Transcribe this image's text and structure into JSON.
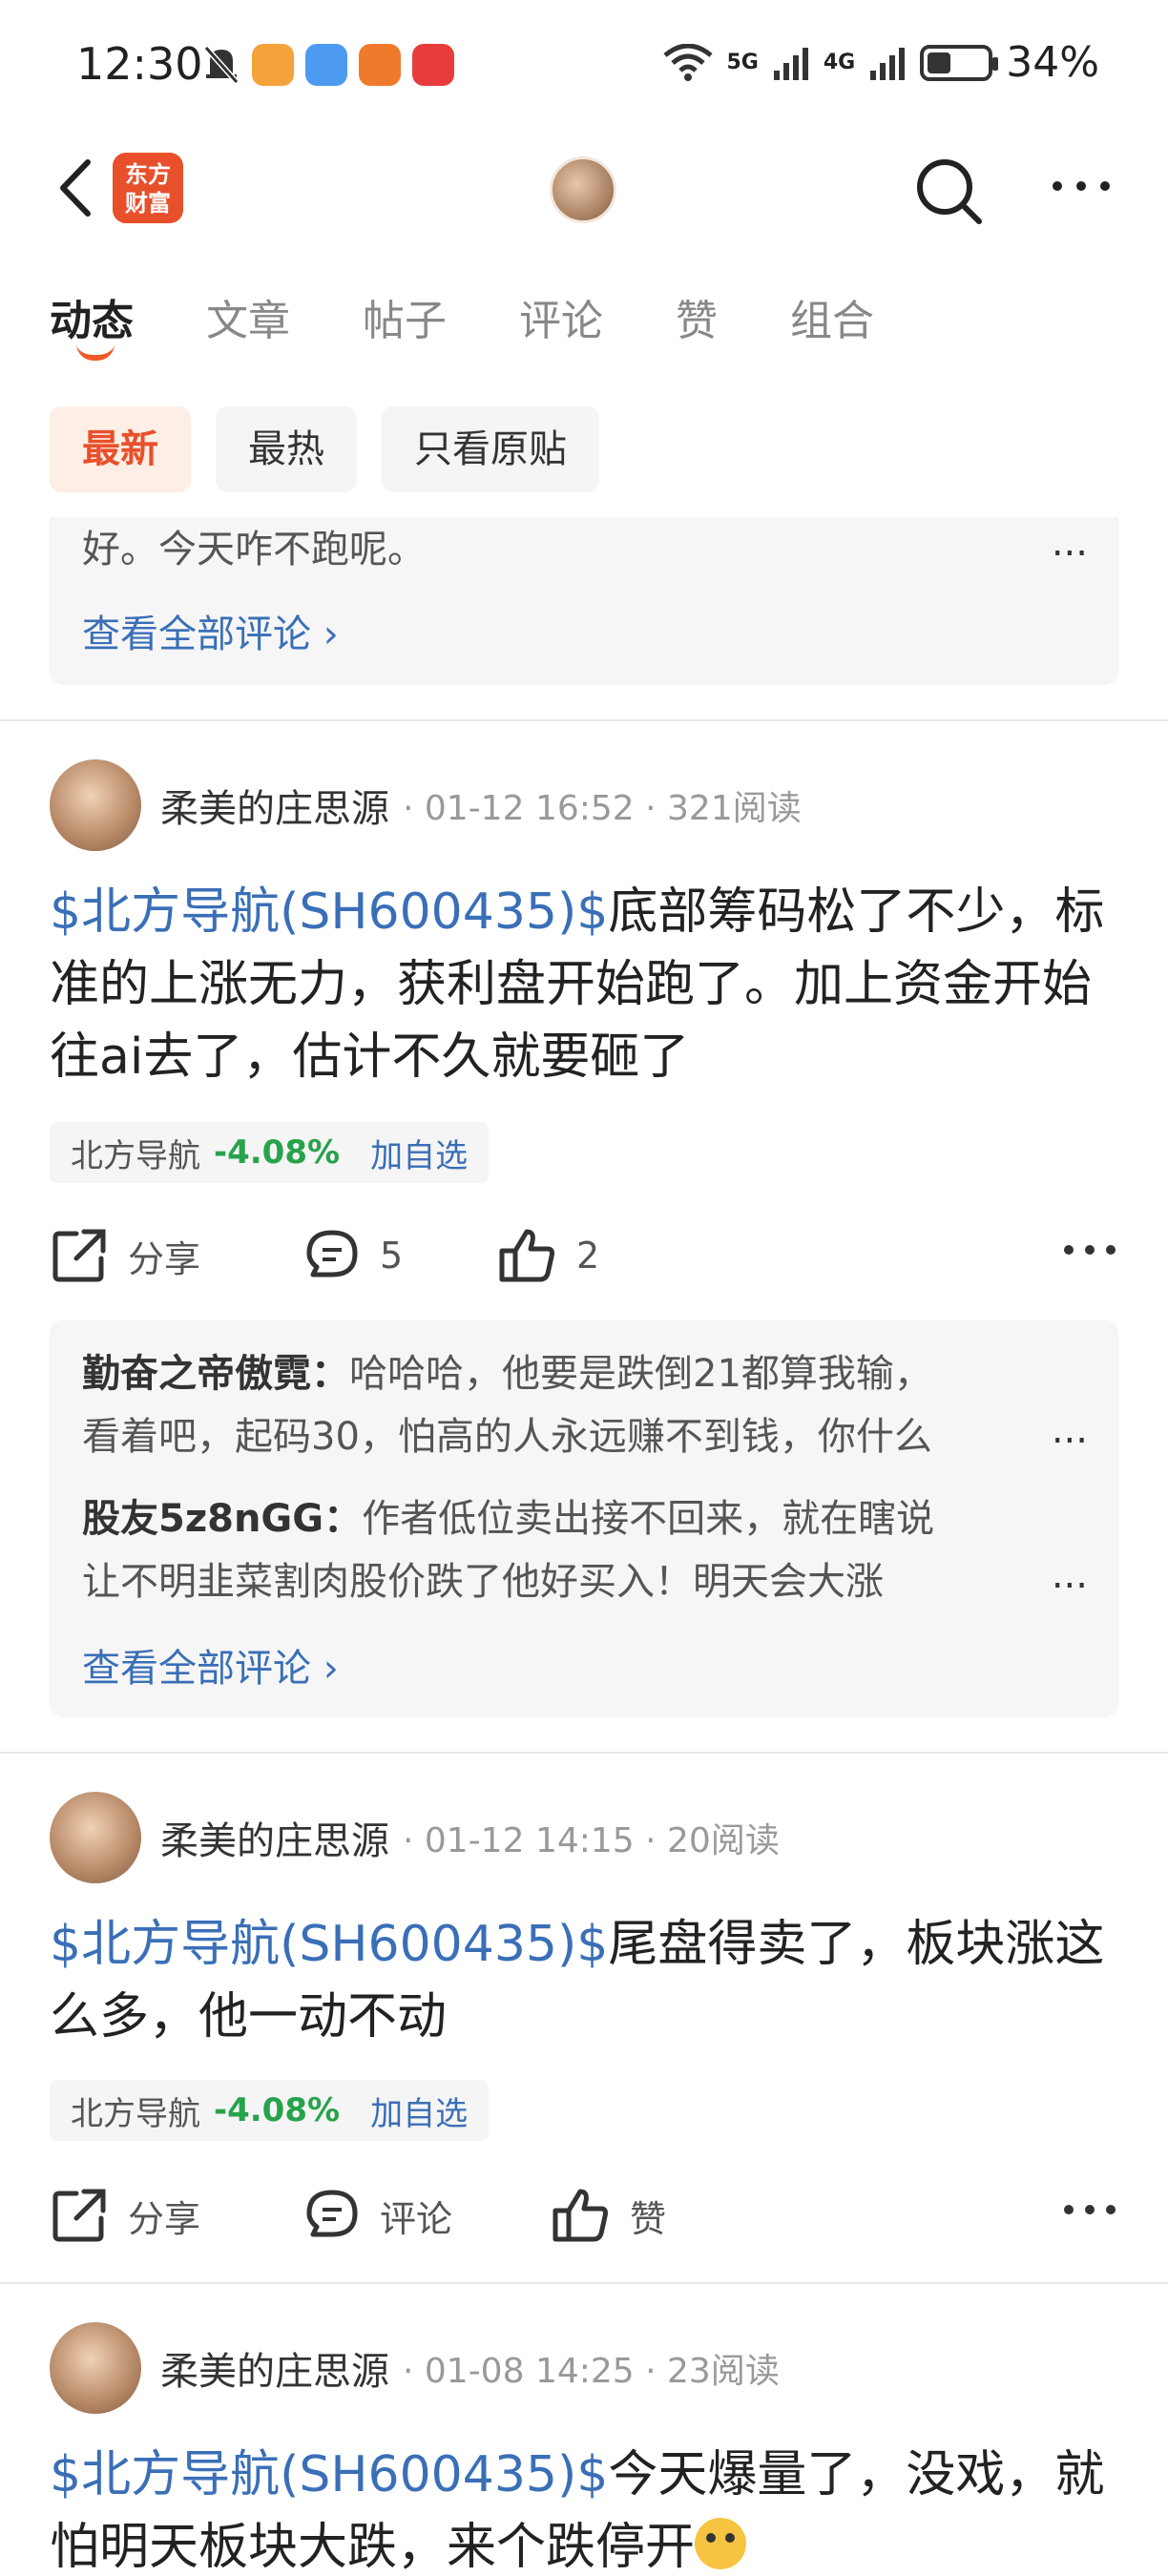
{
  "status_bar": {
    "time": "12:30",
    "net1": "5G",
    "net2": "4G",
    "battery": "34%"
  },
  "nav": {
    "logo_text": "东方\n财富"
  },
  "tabs": [
    {
      "label": "动态",
      "active": true
    },
    {
      "label": "文章"
    },
    {
      "label": "帖子"
    },
    {
      "label": "评论"
    },
    {
      "label": "赞"
    },
    {
      "label": "组合"
    }
  ],
  "filters": [
    {
      "label": "最新",
      "active": true
    },
    {
      "label": "最热"
    },
    {
      "label": "只看原贴"
    }
  ],
  "top_comment_box": {
    "partial_line": "好。今天咋不跑呢。",
    "more": "...",
    "view_all": "查看全部评论"
  },
  "posts": [
    {
      "author": "柔美的庄思源",
      "meta": "· 01-12 16:52 · 321阅读",
      "stock_link": "$北方导航(SH600435)$",
      "text": "底部筹码松了不少，标准的上涨无力，获利盘开始跑了。加上资金开始往ai去了，估计不久就要砸了",
      "tag": {
        "name": "北方导航",
        "pct": "-4.08%",
        "add": "加自选"
      },
      "actions": {
        "share": "分享",
        "comment": "5",
        "like": "2"
      },
      "comments": [
        {
          "user": "勤奋之帝傲霓：",
          "line1": "哈哈哈，他要是跌倒21都算我输，",
          "line2": "看着吧，起码30，怕高的人永远赚不到钱，你什么",
          "more": "..."
        },
        {
          "user": "股友5z8nGG：",
          "line1": "作者低位卖出接不回来，就在瞎说",
          "line2": "让不明韭菜割肉股价跌了他好买入！明天会大涨",
          "more": "..."
        }
      ],
      "view_all": "查看全部评论"
    },
    {
      "author": "柔美的庄思源",
      "meta": "· 01-12 14:15 · 20阅读",
      "stock_link": "$北方导航(SH600435)$",
      "text": "尾盘得卖了，板块涨这么多，他一动不动",
      "tag": {
        "name": "北方导航",
        "pct": "-4.08%",
        "add": "加自选"
      },
      "actions": {
        "share": "分享",
        "comment": "评论",
        "like": "赞"
      }
    },
    {
      "author": "柔美的庄思源",
      "meta": "· 01-08 14:25 · 23阅读",
      "stock_link": "$北方导航(SH600435)$",
      "text": "今天爆量了，没戏，就怕明天板块大跌，来个跌停开"
    }
  ]
}
